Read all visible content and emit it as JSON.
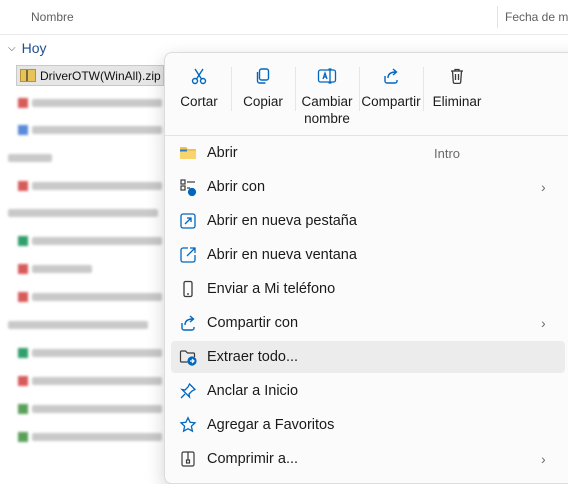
{
  "explorer": {
    "col_name": "Nombre",
    "col_date": "Fecha de m",
    "group_label": "Hoy",
    "selected_file": "DriverOTW(WinAll).zip"
  },
  "context_menu": {
    "actions": [
      {
        "label": "Cortar",
        "icon": "scissors-icon"
      },
      {
        "label": "Copiar",
        "icon": "copy-icon"
      },
      {
        "label": "Cambiar\nnombre",
        "icon": "rename-icon"
      },
      {
        "label": "Compartir",
        "icon": "share-icon"
      },
      {
        "label": "Eliminar",
        "icon": "trash-icon"
      }
    ],
    "items": [
      {
        "label": "Abrir",
        "shortcut": "Intro",
        "icon": "folder-icon"
      },
      {
        "label": "Abrir con",
        "has_submenu": true,
        "icon": "open-with-icon"
      },
      {
        "label": "Abrir en nueva pestaña",
        "icon": "new-tab-icon"
      },
      {
        "label": "Abrir en nueva ventana",
        "icon": "new-window-icon"
      },
      {
        "label": "Enviar a Mi teléfono",
        "icon": "phone-icon"
      },
      {
        "label": "Compartir con",
        "has_submenu": true,
        "icon": "share-with-icon"
      },
      {
        "label": "Extraer todo...",
        "icon": "extract-icon"
      },
      {
        "label": "Anclar a Inicio",
        "icon": "pin-icon"
      },
      {
        "label": "Agregar a Favoritos",
        "icon": "star-icon"
      },
      {
        "label": "Comprimir a...",
        "has_submenu": true,
        "icon": "compress-icon"
      }
    ]
  },
  "colors": {
    "accent": "#0067c0",
    "menu_bg": "#fbfbfb",
    "hover_bg": "#ececec",
    "group_text": "#1f4f8f"
  }
}
